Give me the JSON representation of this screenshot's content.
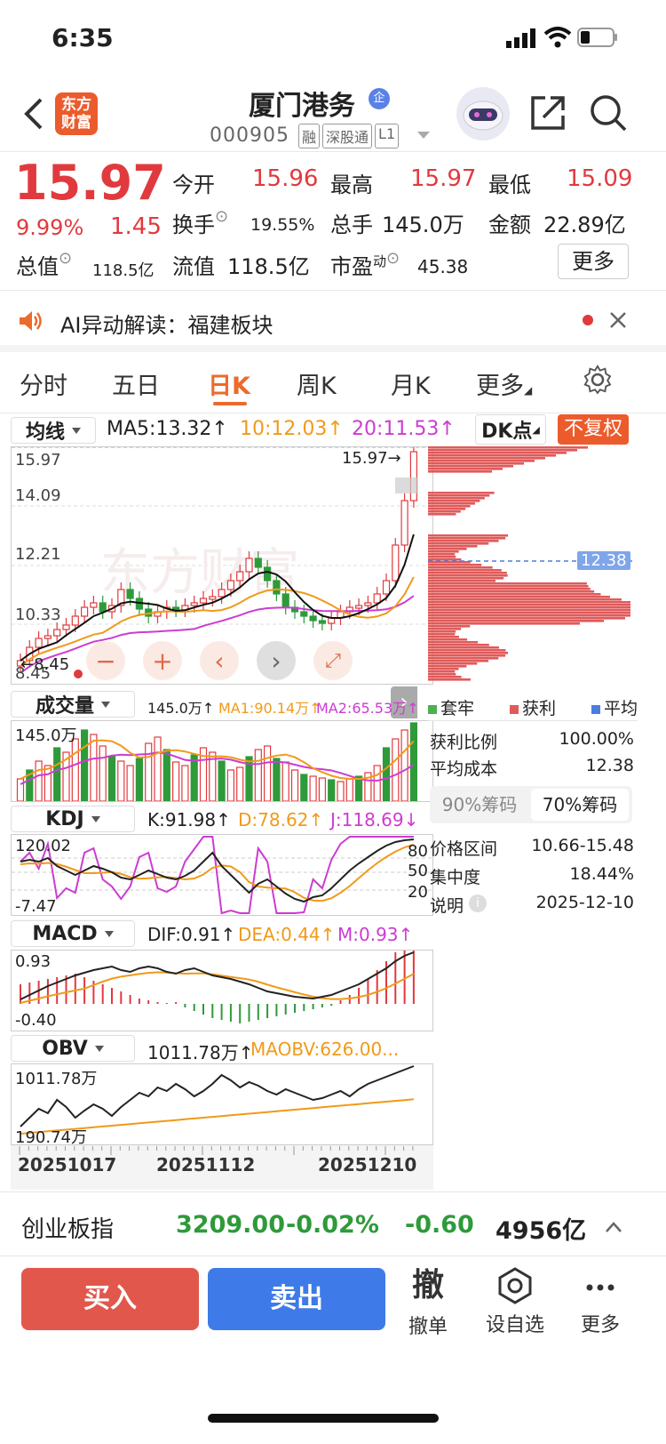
{
  "status_bar": {
    "time": "6:35"
  },
  "header": {
    "logo_text": "东方财富",
    "title": "厦门港务",
    "badge": "企",
    "code": "000905",
    "tags": [
      "融",
      "深股通",
      "L1"
    ]
  },
  "quote": {
    "price": "15.97",
    "change_pct": "9.99%",
    "change": "1.45",
    "open_label": "今开",
    "open": "15.96",
    "high_label": "最高",
    "high": "15.97",
    "low_label": "最低",
    "low": "15.09",
    "turnover_label": "换手",
    "turnover": "19.55%",
    "volume_label": "总手",
    "volume": "145.0万",
    "amount_label": "金额",
    "amount": "22.89亿",
    "mktcap_label": "总值",
    "mktcap": "118.5亿",
    "float_label": "流值",
    "float": "118.5亿",
    "pe_label": "市盈",
    "pe_sup": "动",
    "pe": "45.38",
    "more": "更多"
  },
  "ai_banner": {
    "text": "AI异动解读：福建板块"
  },
  "tabs": [
    "分时",
    "五日",
    "日K",
    "周K",
    "月K",
    "更多"
  ],
  "active_tab": 2,
  "kline": {
    "ma_selector": "均线",
    "ma5": "MA5:13.32↑",
    "ma10": "10:12.03↑",
    "ma20": "20:11.53↑",
    "dk_label": "DK点",
    "adjust_label": "不复权",
    "y_labels": [
      "15.97",
      "14.09",
      "12.21",
      "10.33",
      "8.45"
    ],
    "last_price_marker": "15.97→",
    "low_marker": "←8.45",
    "cost_line_label": "12.38",
    "colors": {
      "up": "#e03a3e",
      "down": "#2e9a3a",
      "ma5": "#111111",
      "ma10": "#f09a1a",
      "ma20": "#cc3cd2"
    }
  },
  "volume": {
    "selector": "成交量",
    "v": "145.0万↑",
    "ma1": "MA1:90.14万↑",
    "ma2": "MA2:65.53万↑",
    "y_label": "145.0万"
  },
  "kdj": {
    "selector": "KDJ",
    "k": "K:91.98↑",
    "d": "D:78.62↑",
    "j": "J:118.69↓",
    "top": "120.02",
    "bottom": "-7.47",
    "levels": [
      "80",
      "50",
      "20"
    ]
  },
  "macd": {
    "selector": "MACD",
    "dif": "DIF:0.91↑",
    "dea": "DEA:0.44↑",
    "m": "M:0.93↑",
    "top": "0.93",
    "bottom": "-0.40"
  },
  "obv": {
    "selector": "OBV",
    "obv": "1011.78万↑",
    "maobv": "MAOBV:626.00...",
    "top": "1011.78万",
    "bottom": "190.74万"
  },
  "dates": [
    "20251017",
    "20251112",
    "20251210"
  ],
  "chips": {
    "legend": [
      "套牢",
      "获利",
      "平均"
    ],
    "profit_ratio_label": "获利比例",
    "profit_ratio": "100.00%",
    "avg_cost_label": "平均成本",
    "avg_cost": "12.38",
    "tab90": "90%筹码",
    "tab70": "70%筹码",
    "range_label": "价格区间",
    "range": "10.66-15.48",
    "concentration_label": "集中度",
    "concentration": "18.44%",
    "note_label": "说明",
    "note": "2025-12-10"
  },
  "index_bar": {
    "name": "创业板指",
    "value": "3209.00",
    "pct": "-0.02%",
    "change": "-0.60",
    "amount": "4956亿"
  },
  "bottom": {
    "buy": "买入",
    "sell": "卖出",
    "cancel_glyph": "撤",
    "cancel": "撤单",
    "watch": "设自选",
    "more": "更多"
  }
}
